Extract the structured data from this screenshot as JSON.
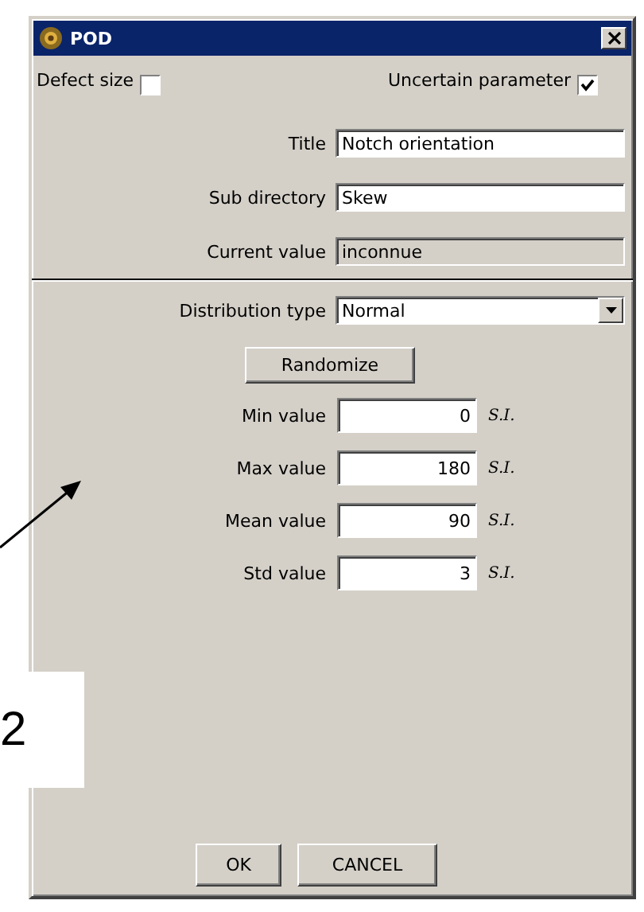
{
  "window": {
    "title": "POD"
  },
  "checkboxes": [
    {
      "label": "Defect size",
      "checked": false
    },
    {
      "label": "Uncertain parameter",
      "checked": true
    }
  ],
  "fields": [
    {
      "label": "Title",
      "value": "Notch orientation",
      "disabled": false
    },
    {
      "label": "Sub directory",
      "value": "Skew",
      "disabled": false
    },
    {
      "label": "Current value",
      "value": "inconnue",
      "disabled": true
    }
  ],
  "distribution": {
    "label": "Distribution type",
    "value": "Normal"
  },
  "randomize_button": "Randomize",
  "values": [
    {
      "label": "Min value",
      "value": "0",
      "unit": "S.I."
    },
    {
      "label": "Max value",
      "value": "180",
      "unit": "S.I."
    },
    {
      "label": "Mean value",
      "value": "90",
      "unit": "S.I."
    },
    {
      "label": "Std value",
      "value": "3",
      "unit": "S.I."
    }
  ],
  "buttons": [
    "OK",
    "CANCEL"
  ],
  "annotation": {
    "label": "2"
  }
}
